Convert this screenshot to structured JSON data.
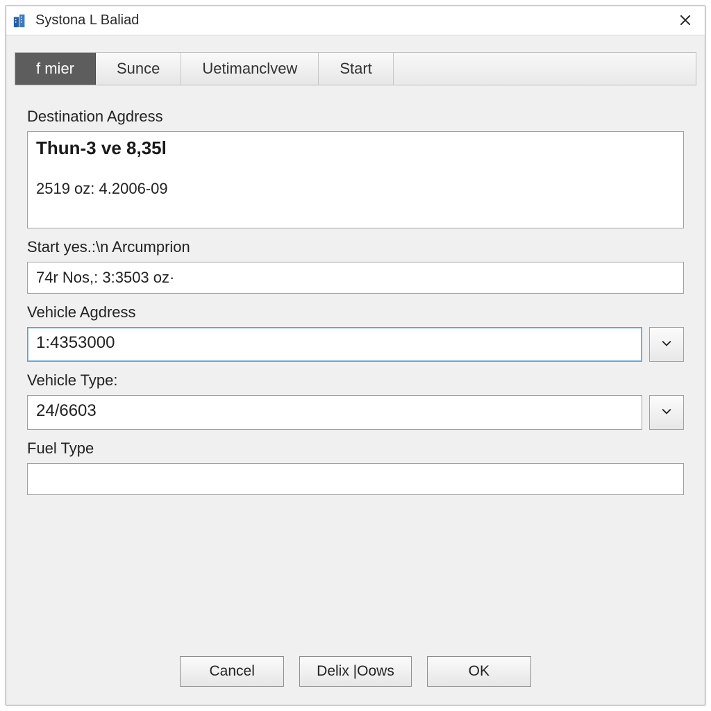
{
  "window": {
    "title": "Systona L Baliad"
  },
  "tabs": {
    "items": [
      {
        "label": "f mier",
        "active": true
      },
      {
        "label": "Sunce",
        "active": false
      },
      {
        "label": "Uetimanclvew",
        "active": false
      },
      {
        "label": "Start",
        "active": false
      }
    ]
  },
  "form": {
    "destination": {
      "label": "Destination Agdress",
      "line1": "Thun-3 ve 8,35l",
      "line2": "2519 oz: 4.2006-09"
    },
    "start": {
      "label": "Start yes.:\\n Arcumprion",
      "value": "74r Nos,: 3:3503 oz·"
    },
    "vehicle_address": {
      "label": "Vehicle Agdress",
      "value": "1:4353000"
    },
    "vehicle_type": {
      "label": "Vehicle Type:",
      "value": "24/6603"
    },
    "fuel_type": {
      "label": "Fuel Type",
      "value": ""
    }
  },
  "buttons": {
    "cancel": "Cancel",
    "middle": "Delix |Oows",
    "ok": "OK"
  }
}
